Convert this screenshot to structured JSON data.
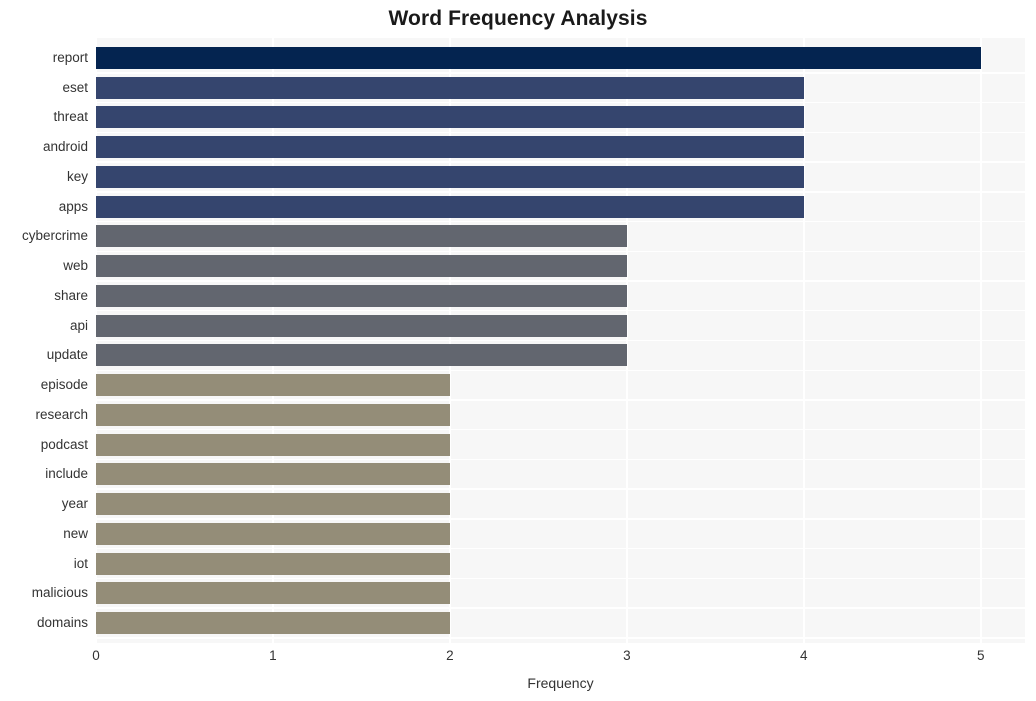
{
  "chart_data": {
    "type": "bar",
    "orientation": "horizontal",
    "title": "Word Frequency Analysis",
    "xlabel": "Frequency",
    "ylabel": "",
    "xlim": [
      0,
      5.25
    ],
    "xticks": [
      0,
      1,
      2,
      3,
      4,
      5
    ],
    "xtick_labels": [
      "0",
      "1",
      "2",
      "3",
      "4",
      "5"
    ],
    "grid": true,
    "legend": "none",
    "categories": [
      "report",
      "eset",
      "threat",
      "android",
      "key",
      "apps",
      "cybercrime",
      "web",
      "share",
      "api",
      "update",
      "episode",
      "research",
      "podcast",
      "include",
      "year",
      "new",
      "iot",
      "malicious",
      "domains"
    ],
    "values": [
      5,
      4,
      4,
      4,
      4,
      4,
      3,
      3,
      3,
      3,
      3,
      2,
      2,
      2,
      2,
      2,
      2,
      2,
      2,
      2
    ],
    "bar_colors": [
      "#042450",
      "#35456e",
      "#35456e",
      "#35456e",
      "#35456e",
      "#35456e",
      "#62666f",
      "#62666f",
      "#62666f",
      "#62666f",
      "#62666f",
      "#948d78",
      "#948d78",
      "#948d78",
      "#948d78",
      "#948d78",
      "#948d78",
      "#948d78",
      "#948d78",
      "#948d78"
    ]
  },
  "style": {
    "plot_background": "#f7f7f7",
    "figure_background": "#ffffff",
    "grid_color": "#ffffff",
    "text_color": "#333333",
    "title_color": "#1a1a1a"
  }
}
